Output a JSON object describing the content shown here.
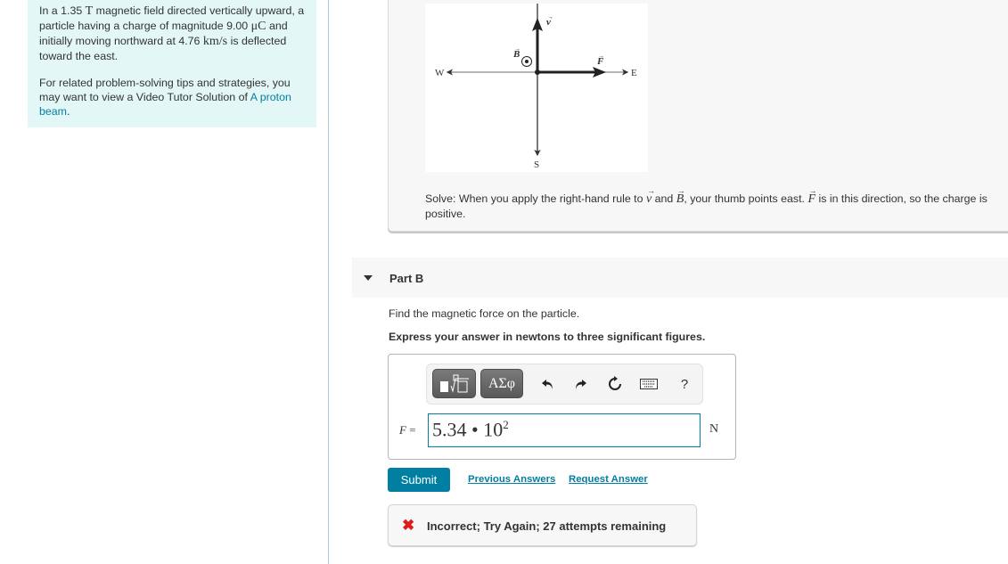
{
  "problem": {
    "statement_parts": {
      "p1": "In a 1.35 ",
      "unit_T": "T",
      "p2": " magnetic field directed vertically upward, a particle having a charge of magnitude 9.00 ",
      "unit_uC": "μC",
      "p3": " and initially moving northward at 4.76 ",
      "unit_kms": "km/s",
      "p4": " is deflected toward the east."
    },
    "tip_text": "For related problem-solving tips and strategies, you may want to view a Video Tutor Solution of ",
    "tip_link": "A proton beam",
    "tip_end": "."
  },
  "diagram": {
    "labels": {
      "west": "W",
      "east": "E",
      "south": "S",
      "velocity": "v",
      "field": "B",
      "force": "F"
    }
  },
  "solution": {
    "t1": "Solve: When you apply the right-hand rule to ",
    "v": "v",
    "t2": " and ",
    "B": "B",
    "t3": ", your thumb points east. ",
    "F": "F",
    "t4": " is in this direction, so the charge is positive."
  },
  "part_b": {
    "label": "Part B",
    "question": "Find the magnetic force on the particle.",
    "instruction": "Express your answer in newtons to three significant figures.",
    "toolbar": {
      "greek_label": "ΑΣφ",
      "help_label": "?"
    },
    "variable": "F",
    "equals": " =",
    "answer_mantissa": "5.34 • 10",
    "answer_exponent": "2",
    "unit": "N",
    "submit_label": "Submit",
    "previous_answers_label": "Previous Answers",
    "request_answer_label": "Request Answer",
    "feedback": "Incorrect; Try Again; 27 attempts remaining"
  },
  "colors": {
    "accent": "#007fa3",
    "panel_bg": "#e3f7f7",
    "error": "#e01b1b"
  }
}
